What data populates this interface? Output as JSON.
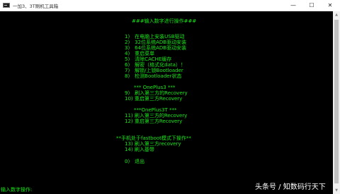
{
  "window": {
    "title": "一加3、3T刷机工具箱",
    "min_glyph": "—",
    "max_glyph": "☐",
    "close_glyph": "✕",
    "text_color": "#17e817"
  },
  "console": {
    "header": "###输入数字进行操作###",
    "menu_1": [
      "1)　在电脑上安装USB驱动",
      "2)　32位系统ADB驱动安装",
      "3)　64位系统ADB驱动安装",
      "4)　重启菜单",
      "5)　清除CACHE缓存",
      "6)　解密（格式化data）！",
      "7)　解锁/上锁Bootloader",
      "8)　检测Bootloader状态"
    ],
    "section_op3": "*** OnePlus3 ***",
    "menu_op3": [
      "9)　刷入第三方的Recovery",
      "10) 重启第三方Recovery"
    ],
    "section_op3t": "***OnePlus3T ***",
    "menu_op3t": [
      "11) 刷入第三方的Recovery",
      "12) 重启第三方Recovery"
    ],
    "section_fastboot": "**手机处于fastboot模式下操作**",
    "menu_fastboot": [
      "13) 刷入第三方recovery",
      "14) 刷入基带"
    ],
    "exit": "0)　退出",
    "prompt": "输入数字操作:"
  },
  "watermark": "头条号 / 知数码行天下"
}
